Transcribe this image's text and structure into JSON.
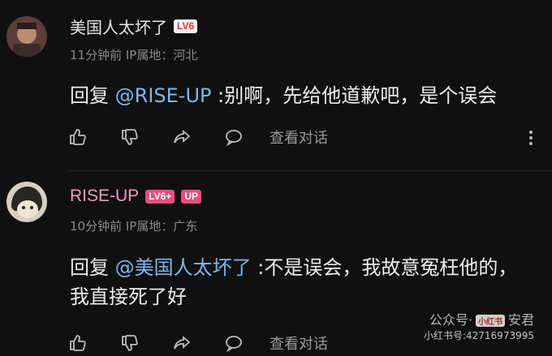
{
  "comments": [
    {
      "username": "美国人太坏了",
      "level_badge": "LV6",
      "meta": "11分钟前 IP属地：河北",
      "reply_prefix": "回复",
      "mention": "@RISE-UP",
      "text": ":别啊，先给他道歉吧，是个误会",
      "view_dialog": "查看对话"
    },
    {
      "username": "RISE-UP",
      "level_badge": "LV6+",
      "up_badge": "UP",
      "meta": "10分钟前 IP属地：广东",
      "reply_prefix": "回复",
      "mention": "@美国人太坏了",
      "text": ":不是误会，我故意冤枉他的，我直接死了好",
      "view_dialog": "查看对话"
    }
  ],
  "watermark": {
    "public_label": "公众号·",
    "rb_badge": "小红书",
    "account": "安君",
    "xhs_id": "小红书号:42716973995"
  },
  "icons": {
    "like": "thumb-up-icon",
    "dislike": "thumb-down-icon",
    "share": "share-icon",
    "comment": "comment-bubble-icon",
    "more": "more-vertical-icon"
  }
}
